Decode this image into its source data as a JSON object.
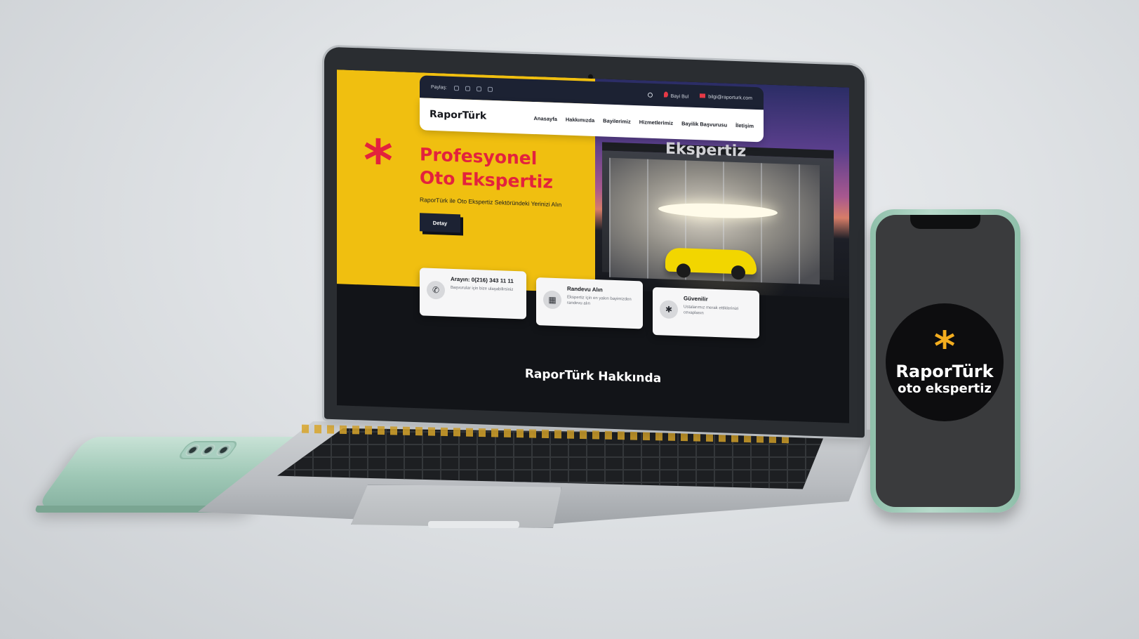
{
  "site": {
    "topbar": {
      "share_label": "Paylaş:",
      "social_icons": [
        "instagram-icon",
        "twitter-icon",
        "facebook-icon",
        "youtube-icon"
      ],
      "dealer_label": "Bayi Bul",
      "email": "bilgi@raporturk.com"
    },
    "logo": "RaporTürk",
    "nav": [
      "Anasayfa",
      "Hakkımızda",
      "Bayilerimiz",
      "Hizmetlerimiz",
      "Bayilik Başvurusu",
      "İletişim"
    ],
    "hero": {
      "asterisk": "*",
      "title_line1": "Profesyonel",
      "title_line2": "Oto Ekspertiz",
      "subtitle": "RaporTürk ile Oto Ekspertiz Sektöründeki Yerinizi Alın",
      "button": "Detay",
      "sign_text": "Ekspertiz"
    },
    "cards": [
      {
        "icon": "phone-icon",
        "glyph": "✆",
        "title": "Arayın: 0(216) 343 11 11",
        "desc": "Başvurular için bize ulaşabilirsiniz"
      },
      {
        "icon": "calendar-icon",
        "glyph": "▦",
        "title": "Randevu Alın",
        "desc": "Ekspertiz için en yakın bayimizden randevu alın"
      },
      {
        "icon": "asterisk-icon",
        "glyph": "✱",
        "title": "Güvenilir",
        "desc": "Ustalarımız merak ettiklerinizi cevaplasın"
      }
    ],
    "about_title": "RaporTürk Hakkında"
  },
  "phone_badge": {
    "asterisk": "*",
    "name": "RaporTürk",
    "tagline": "oto ekspertiz"
  },
  "colors": {
    "brand_yellow": "#f0bf10",
    "brand_red": "#e3223d",
    "navy": "#1c2233",
    "badge_orange": "#f3ad1f"
  }
}
